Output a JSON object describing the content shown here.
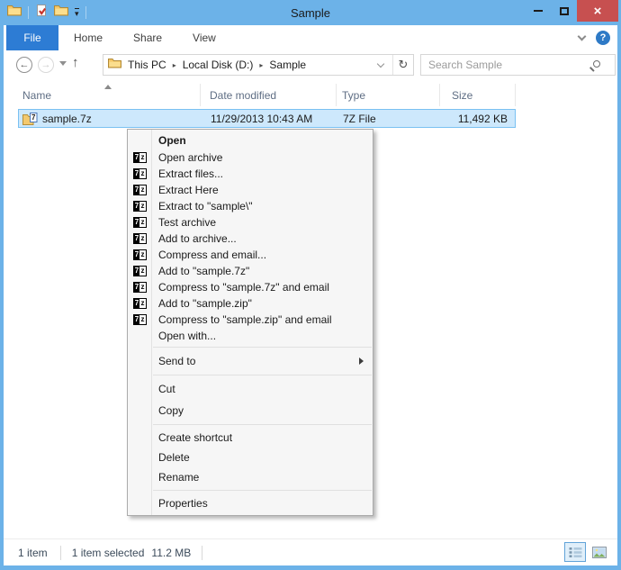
{
  "window": {
    "title": "Sample"
  },
  "ribbon": {
    "tabs": [
      {
        "label": "File",
        "active": true
      },
      {
        "label": "Home",
        "active": false
      },
      {
        "label": "Share",
        "active": false
      },
      {
        "label": "View",
        "active": false
      }
    ]
  },
  "address": {
    "breadcrumbs": [
      "This PC",
      "Local Disk (D:)",
      "Sample"
    ]
  },
  "search": {
    "placeholder": "Search Sample"
  },
  "file_list": {
    "columns": [
      "Name",
      "Date modified",
      "Type",
      "Size"
    ],
    "sort_column": "Name",
    "sort_direction": "ascending",
    "rows": [
      {
        "name": "sample.7z",
        "date_modified": "11/29/2013 10:43 AM",
        "type": "7Z File",
        "size": "11,492 KB",
        "selected": true
      }
    ]
  },
  "context_menu": {
    "items": [
      {
        "label": "Open",
        "bold": true
      },
      {
        "label": "Open archive",
        "icon": "7zip"
      },
      {
        "label": "Extract files...",
        "icon": "7zip"
      },
      {
        "label": "Extract Here",
        "icon": "7zip"
      },
      {
        "label": "Extract to \"sample\\\"",
        "icon": "7zip"
      },
      {
        "label": "Test archive",
        "icon": "7zip"
      },
      {
        "label": "Add to archive...",
        "icon": "7zip"
      },
      {
        "label": "Compress and email...",
        "icon": "7zip"
      },
      {
        "label": "Add to \"sample.7z\"",
        "icon": "7zip"
      },
      {
        "label": "Compress to \"sample.7z\" and email",
        "icon": "7zip"
      },
      {
        "label": "Add to \"sample.zip\"",
        "icon": "7zip"
      },
      {
        "label": "Compress to \"sample.zip\" and email",
        "icon": "7zip"
      },
      {
        "label": "Open with..."
      },
      {
        "label": "Send to",
        "submenu": true
      },
      {
        "label": "Cut"
      },
      {
        "label": "Copy"
      },
      {
        "label": "Create shortcut"
      },
      {
        "label": "Delete"
      },
      {
        "label": "Rename"
      },
      {
        "label": "Properties"
      }
    ]
  },
  "status_bar": {
    "item_count": "1 item",
    "selection": "1 item selected",
    "selection_size": "11.2 MB"
  },
  "icons": {
    "back": "←",
    "forward": "→",
    "up": "↑",
    "refresh": "↻",
    "help": "?",
    "close": "×",
    "qat_dropdown": "▾",
    "breadcrumb_separator": "▸",
    "seven_zip_left": "7",
    "seven_zip_right": "z",
    "file_icon_digit": "7"
  },
  "colors": {
    "accent": "#6CB2E8",
    "tab_active": "#2D7CD4",
    "close_button": "#C75050",
    "selection_bg": "#CDE8FC",
    "selection_border": "#7AC1F2",
    "help": "#2E7AC6"
  }
}
